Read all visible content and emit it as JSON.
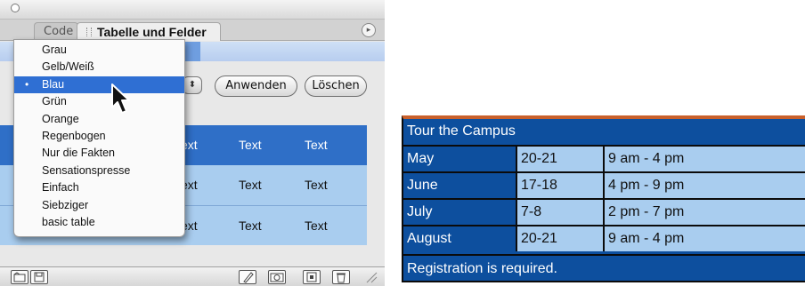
{
  "panel": {
    "tabs": [
      {
        "label": "Code"
      },
      {
        "label": "Tabelle und Felder"
      }
    ],
    "buttons": {
      "apply_label": "Anwenden",
      "delete_label": "Löschen"
    },
    "preview": {
      "rows": [
        [
          "Text",
          "Text",
          "Text"
        ],
        [
          "Text",
          "Text",
          "Text"
        ],
        [
          "Text",
          "Text",
          "Text"
        ]
      ]
    },
    "dropdown": {
      "selected_label": "Blau",
      "items": [
        {
          "label": "Grau"
        },
        {
          "label": "Gelb/Weiß"
        },
        {
          "label": "Blau",
          "bullet": "•"
        },
        {
          "label": "Grün"
        },
        {
          "label": "Orange"
        },
        {
          "label": "Regenbogen"
        },
        {
          "label": "Nur die Fakten"
        },
        {
          "label": "Sensationspresse"
        },
        {
          "label": "Einfach"
        },
        {
          "label": "Siebziger"
        },
        {
          "label": "basic table"
        }
      ]
    },
    "icons": {
      "panel_menu": "panel-menu-icon",
      "new_document": "folder-icon",
      "save": "save-icon",
      "edit": "pencil-icon",
      "image": "camera-icon",
      "new_item": "new-item-icon",
      "trash": "trash-icon"
    },
    "colors": {
      "selection": "#2f6fd3",
      "preview_header": "#2f6fc7",
      "preview_body": "#a9cdef"
    }
  },
  "schedule": {
    "title": "Tour the Campus",
    "rows": [
      {
        "month": "May",
        "dates": "20-21",
        "time": "9 am - 4 pm"
      },
      {
        "month": "June",
        "dates": "17-18",
        "time": "4 pm - 9 pm"
      },
      {
        "month": "July",
        "dates": "7-8",
        "time": "2 pm - 7 pm"
      },
      {
        "month": "August",
        "dates": "20-21",
        "time": "9 am - 4 pm"
      }
    ],
    "note": "Registration is required.",
    "colors": {
      "header": "#0d4f9e",
      "cell": "#a9cdef",
      "accent": "#c9602b"
    }
  }
}
